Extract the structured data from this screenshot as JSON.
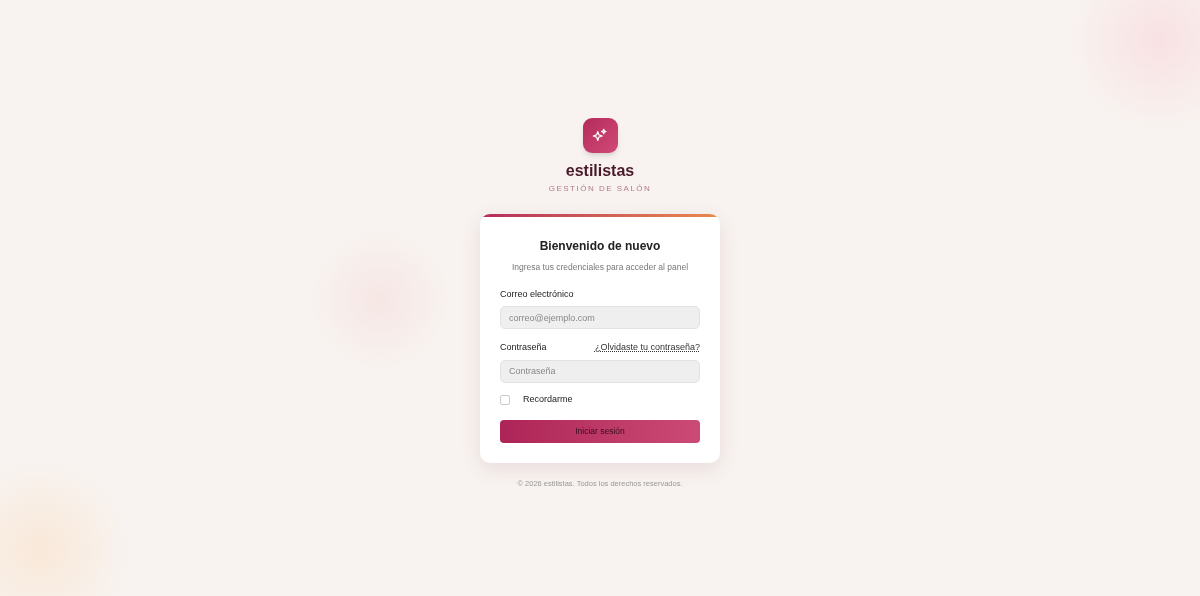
{
  "brand": {
    "name": "estilistas",
    "tagline": "GESTIÓN DE SALÓN"
  },
  "card": {
    "title": "Bienvenido de nuevo",
    "subtitle": "Ingresa tus credenciales para acceder al panel",
    "email": {
      "label": "Correo electrónico",
      "placeholder": "correo@ejemplo.com"
    },
    "password": {
      "label": "Contraseña",
      "placeholder": "Contraseña",
      "forgot_link": "¿Olvidaste tu contraseña?"
    },
    "remember": {
      "label": "Recordarme",
      "checked": false
    },
    "submit": "Iniciar sesión"
  },
  "footer": "© 2026 estilistas. Todos los derechos reservados."
}
